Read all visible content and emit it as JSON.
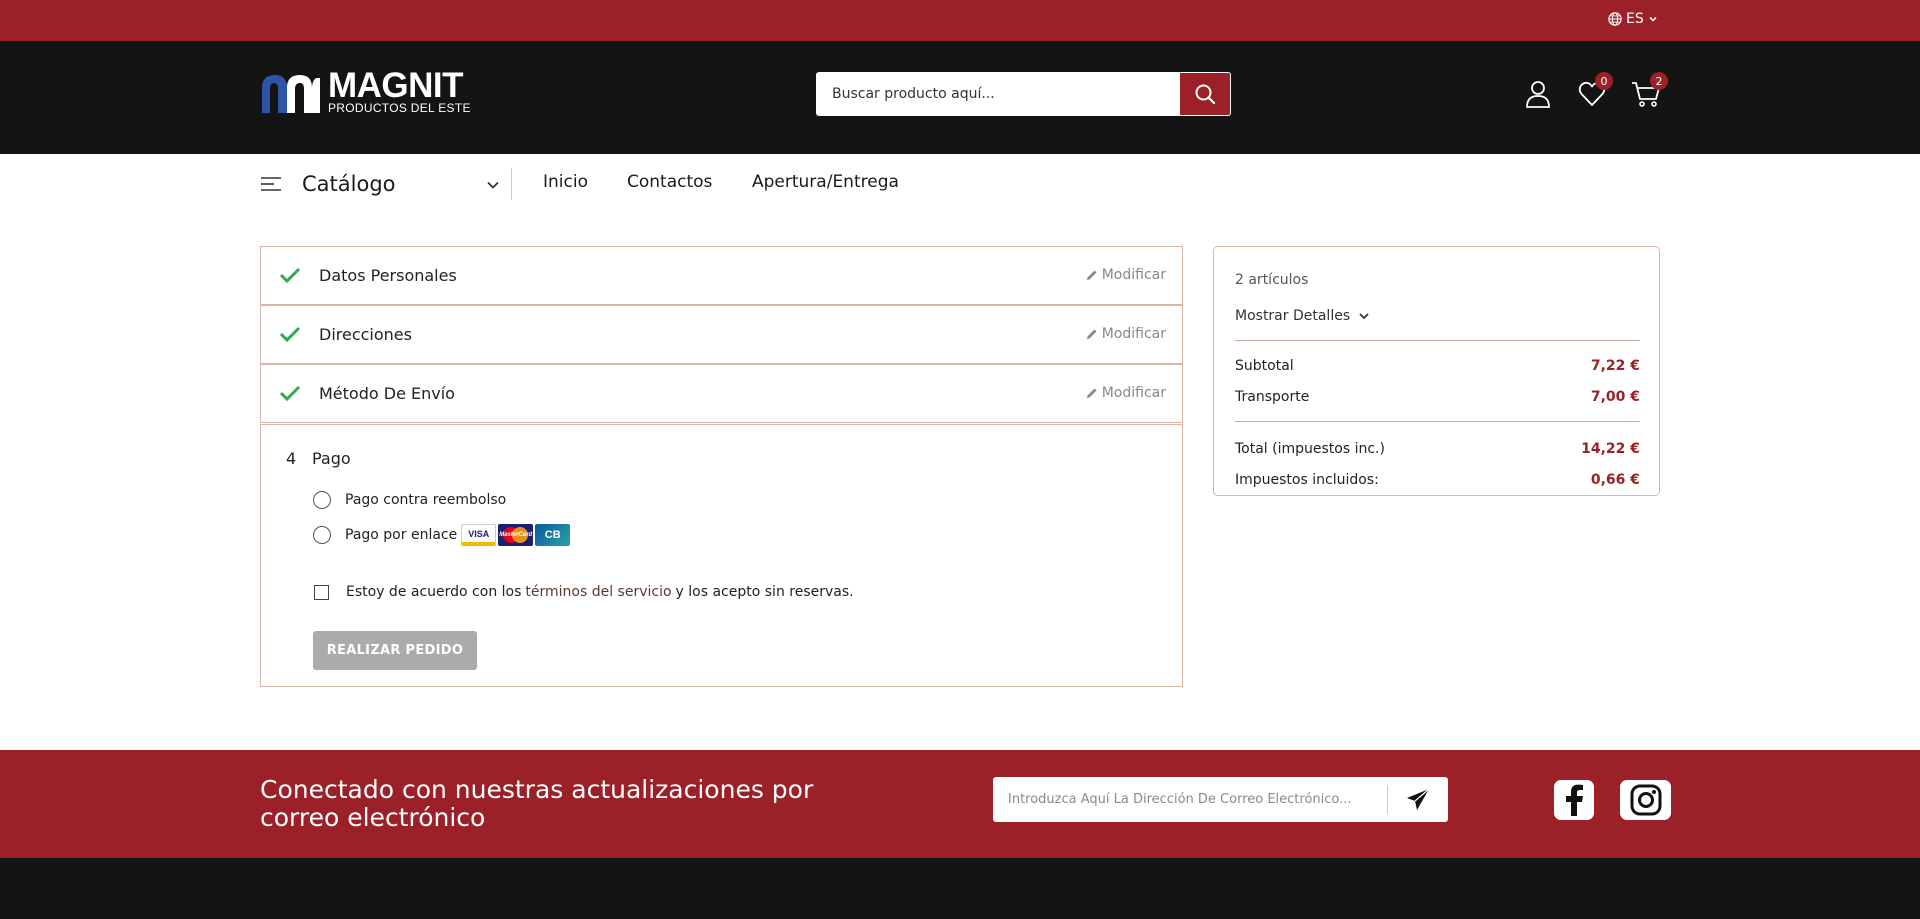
{
  "topbar": {
    "language": "ES",
    "bg_color": "#9b2027"
  },
  "header": {
    "logo_title": "MAGNIT",
    "logo_subtitle": "PRODUCTOS DEL ESTE",
    "search_placeholder": "Buscar producto aquí...",
    "wishlist_count": "0",
    "cart_count": "2",
    "icons": [
      "user-icon",
      "heart-icon",
      "cart-icon",
      "search-icon"
    ]
  },
  "nav": {
    "catalog_label": "Catálogo",
    "links": [
      "Inicio",
      "Contactos",
      "Apertura/Entrega"
    ]
  },
  "checkout": {
    "steps": [
      {
        "title": "Datos Personales",
        "action": "Modificar",
        "done": true
      },
      {
        "title": "Direcciones",
        "action": "Modificar",
        "done": true
      },
      {
        "title": "Método De Envío",
        "action": "Modificar",
        "done": true
      }
    ],
    "payment": {
      "number": "4",
      "title": "Pago",
      "options": [
        "Pago contra reembolso",
        "Pago por enlace"
      ],
      "card_logos": [
        "VISA",
        "MasterCard",
        "CB"
      ],
      "terms_before": "Estoy de acuerdo con los",
      "terms_link": "términos del servicio",
      "terms_after": "y los acepto sin reservas.",
      "submit_label": "REALIZAR PEDIDO"
    }
  },
  "summary": {
    "items_count": "2 artículos",
    "details_label": "Mostrar Detalles",
    "subtotal_label": "Subtotal",
    "subtotal_value": "7,22 €",
    "shipping_label": "Transporte",
    "shipping_value": "7,00 €",
    "total_label": "Total (impuestos inc.)",
    "total_value": "14,22 €",
    "taxes_label": "Impuestos incluidos:",
    "taxes_value": "0,66 €"
  },
  "footer": {
    "newsletter_title": "Conectado con nuestras actualizaciones por correo electrónico",
    "email_placeholder": "Introduzca Aquí La Dirección De Correo Electrónico...",
    "social": [
      "facebook-icon",
      "instagram-icon"
    ]
  },
  "colors": {
    "brand": "#9b2027",
    "dark": "#141414",
    "check": "#2eab4f",
    "border": "#d8b5a6"
  }
}
